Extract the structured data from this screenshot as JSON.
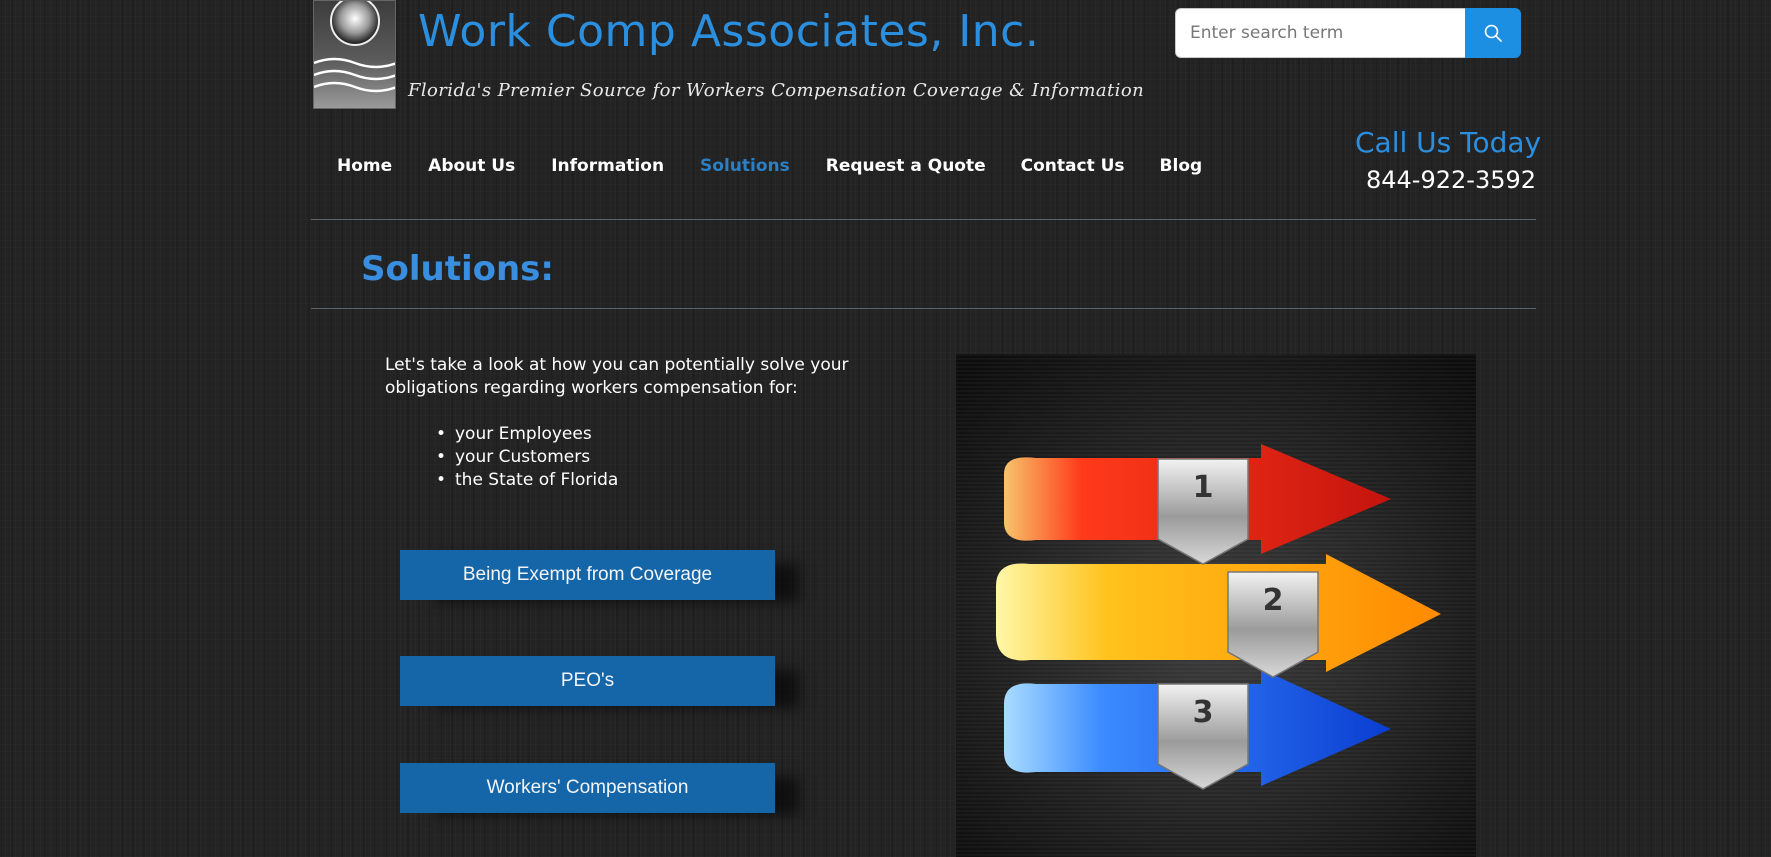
{
  "header": {
    "site_title": "Work Comp Associates, Inc.",
    "tagline": "Florida's Premier Source for Workers Compensation Coverage & Information",
    "logo_icon": "wave-sun-logo"
  },
  "search": {
    "placeholder": "Enter search term",
    "value": "",
    "button_icon": "search-icon"
  },
  "nav": {
    "items": [
      {
        "label": "Home",
        "active": false
      },
      {
        "label": "About Us",
        "active": false
      },
      {
        "label": "Information",
        "active": false
      },
      {
        "label": "Solutions",
        "active": true
      },
      {
        "label": "Request a Quote",
        "active": false
      },
      {
        "label": "Contact Us",
        "active": false
      },
      {
        "label": "Blog",
        "active": false
      }
    ]
  },
  "contact": {
    "call_label": "Call Us Today",
    "phone": "844-922-3592"
  },
  "main": {
    "page_title": "Solutions:",
    "intro": "Let's take a look at how you can potentially solve your obligations regarding workers compensation for:",
    "bullets": [
      "your Employees",
      "your Customers",
      "the State of Florida"
    ],
    "buttons": [
      "Being Exempt from Coverage",
      "PEO's",
      "Workers' Compensation"
    ],
    "image": {
      "description_icon": "numbered-arrows-image",
      "arrow_labels": [
        "1",
        "2",
        "3"
      ]
    }
  },
  "colors": {
    "accent": "#2b8fe0",
    "button_blue": "#1566a8",
    "nav_active": "#2b7fc4",
    "search_button": "#1c8fe3",
    "background": "#232323"
  }
}
